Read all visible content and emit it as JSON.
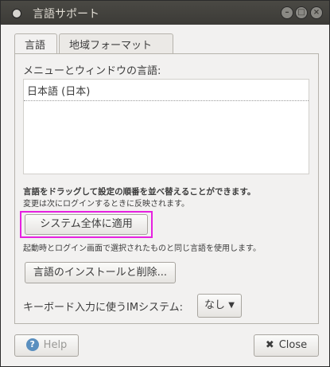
{
  "window": {
    "title": "言語サポート",
    "controls": [
      "minimize",
      "maximize",
      "close"
    ]
  },
  "tabs": [
    {
      "label": "言語",
      "active": true
    },
    {
      "label": "地域フォーマット",
      "active": false
    }
  ],
  "language_tab": {
    "menu_label": "メニューとウィンドウの言語:",
    "languages": [
      "日本語 (日本)"
    ],
    "drag_hint": "言語をドラッグして設定の順番を並べ替えることができます。",
    "change_hint": "変更は次にログインするときに反映されます。",
    "apply_button": "システム全体に適用",
    "startup_hint": "起動時とログイン画面で選択されたものと同じ言語を使用します。",
    "install_button": "言語のインストールと削除...",
    "im_label": "キーボード入力に使うIMシステム:",
    "im_selected": "なし"
  },
  "footer": {
    "help_label": "Help",
    "close_label": "Close"
  },
  "icons": {
    "help": "help-circle-icon",
    "close": "x-icon",
    "dropdown": "chevron-down-icon"
  },
  "colors": {
    "highlight": "#e621e0",
    "titlebar": "#3c3b37",
    "help_icon": "#5a8fbf"
  }
}
